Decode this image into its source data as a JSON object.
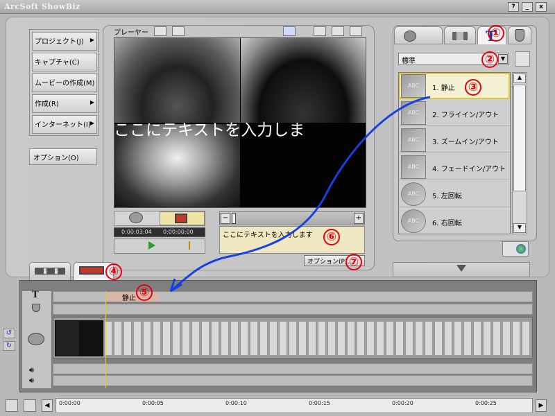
{
  "app": {
    "title": "ArcSoft ShowBiz",
    "win_buttons": [
      "?",
      "_",
      "x"
    ]
  },
  "menu": {
    "items": [
      {
        "label": "プロジェクト(J)",
        "arrow": "▶"
      },
      {
        "label": "キャプチャ(C)",
        "arrow": ""
      },
      {
        "label": "ムービーの作成(M)",
        "arrow": ""
      },
      {
        "label": "作成(R)",
        "arrow": "▶"
      },
      {
        "label": "インターネット(I)",
        "arrow": "▶"
      }
    ],
    "options": "オプション(O)"
  },
  "player": {
    "title": "プレーヤー",
    "overlay_text": "ここにテキストを入力しま",
    "time_current": "0:00:03:04",
    "time_total": "0:00:00:00",
    "text_input": "ここにテキストを入力します",
    "options_button": "オプション(P)..."
  },
  "effects": {
    "category": "標準",
    "items": [
      "1. 静止",
      "2. フライイン/アウト",
      "3. ズームイン/アウト",
      "4. フェードイン/アウト",
      "5. 左回転",
      "6. 右回転"
    ],
    "icon_label": "ABC"
  },
  "timeline": {
    "text_clip": "静止",
    "ticks": [
      "0:00:00",
      "0:00:05",
      "0:00:10",
      "0:00:15",
      "0:00:20",
      "0:00:25"
    ]
  },
  "annotations": [
    "①",
    "②",
    "③",
    "④",
    "⑤",
    "⑥",
    "⑦"
  ],
  "colors": {
    "annotation": "#e3000f",
    "arrow": "#1740e0",
    "selected": "#f4f1d4"
  }
}
